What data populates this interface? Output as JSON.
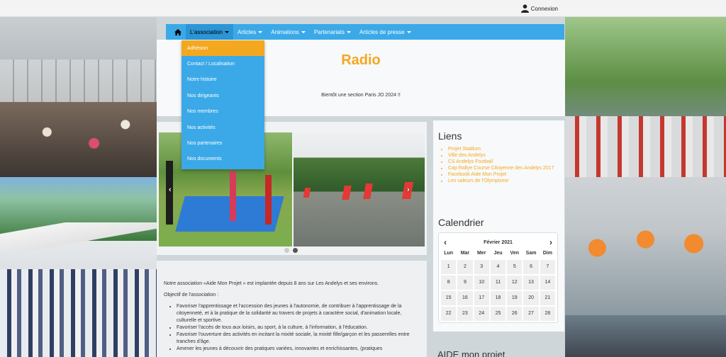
{
  "topbar": {
    "connexion_label": "Connexion",
    "icon": "user-icon"
  },
  "nav": {
    "home_icon": "home-icon",
    "items": [
      {
        "label": "L'association"
      },
      {
        "label": "Articles"
      },
      {
        "label": "Animations"
      },
      {
        "label": "Partenariats"
      },
      {
        "label": "Articles de presse"
      }
    ]
  },
  "dropdown": {
    "items": [
      "Adhésion",
      "Contact / Localisation",
      "Notre histoire",
      "Nos dirigeants",
      "Nos membres",
      "Nos activités",
      "Nos partenaires",
      "Nos documents"
    ]
  },
  "hero": {
    "title": "Radio",
    "subtitle": "Bientôt une section Paris JO 2024 !!"
  },
  "slider": {
    "prev": "‹",
    "next": "›"
  },
  "intro": {
    "line1": "Notre association «Aide Mon Projet » est implantée depuis 8 ans sur Les Andelys et ses environs.",
    "line2": "Objectif de l'association :",
    "bullets": [
      "Favoriser l'apprentissage et l'accession des jeunes à l'autonomie, de contribuer à l'apprentissage de la citoyenneté, et à la pratique de la solidarité au travers de projets à caractère social, d'animation locale, culturelle et sportive.",
      "Favoriser l'accès de tous aux loisirs, au sport, à la culture, à l'information, à l'éducation.",
      "Favoriser l'ouverture des activités en incitant la mixité sociale, la mixité fille/garçon et les passerelles entre tranches d'âge.",
      "Amener les jeunes à découvrir des pratiques variées, innovantes et enrichissantes, (pratiques"
    ]
  },
  "links": {
    "title": "Liens",
    "items": [
      "Projet Stadium",
      "Ville des Andelys",
      "CS Andelys Football",
      "Cap Rallye Course Citoyenne des Andelys 2017",
      "Facebook Aide Mon Projet",
      "Les valeurs de l'Olympisme"
    ]
  },
  "calendar": {
    "title": "Calendrier",
    "month": "Février 2021",
    "prev": "‹",
    "next": "›",
    "days": [
      "Lun",
      "Mar",
      "Mer",
      "Jeu",
      "Ven",
      "Sam",
      "Dim"
    ],
    "dates": [
      "1",
      "2",
      "3",
      "4",
      "5",
      "6",
      "7",
      "8",
      "9",
      "10",
      "11",
      "12",
      "13",
      "14",
      "15",
      "16",
      "17",
      "18",
      "19",
      "20",
      "21",
      "22",
      "23",
      "24",
      "25",
      "26",
      "27",
      "28"
    ]
  },
  "aide": {
    "title": "AIDE mon projet"
  },
  "colors": {
    "accent": "#f3a81f",
    "nav": "#3ba9e8"
  }
}
